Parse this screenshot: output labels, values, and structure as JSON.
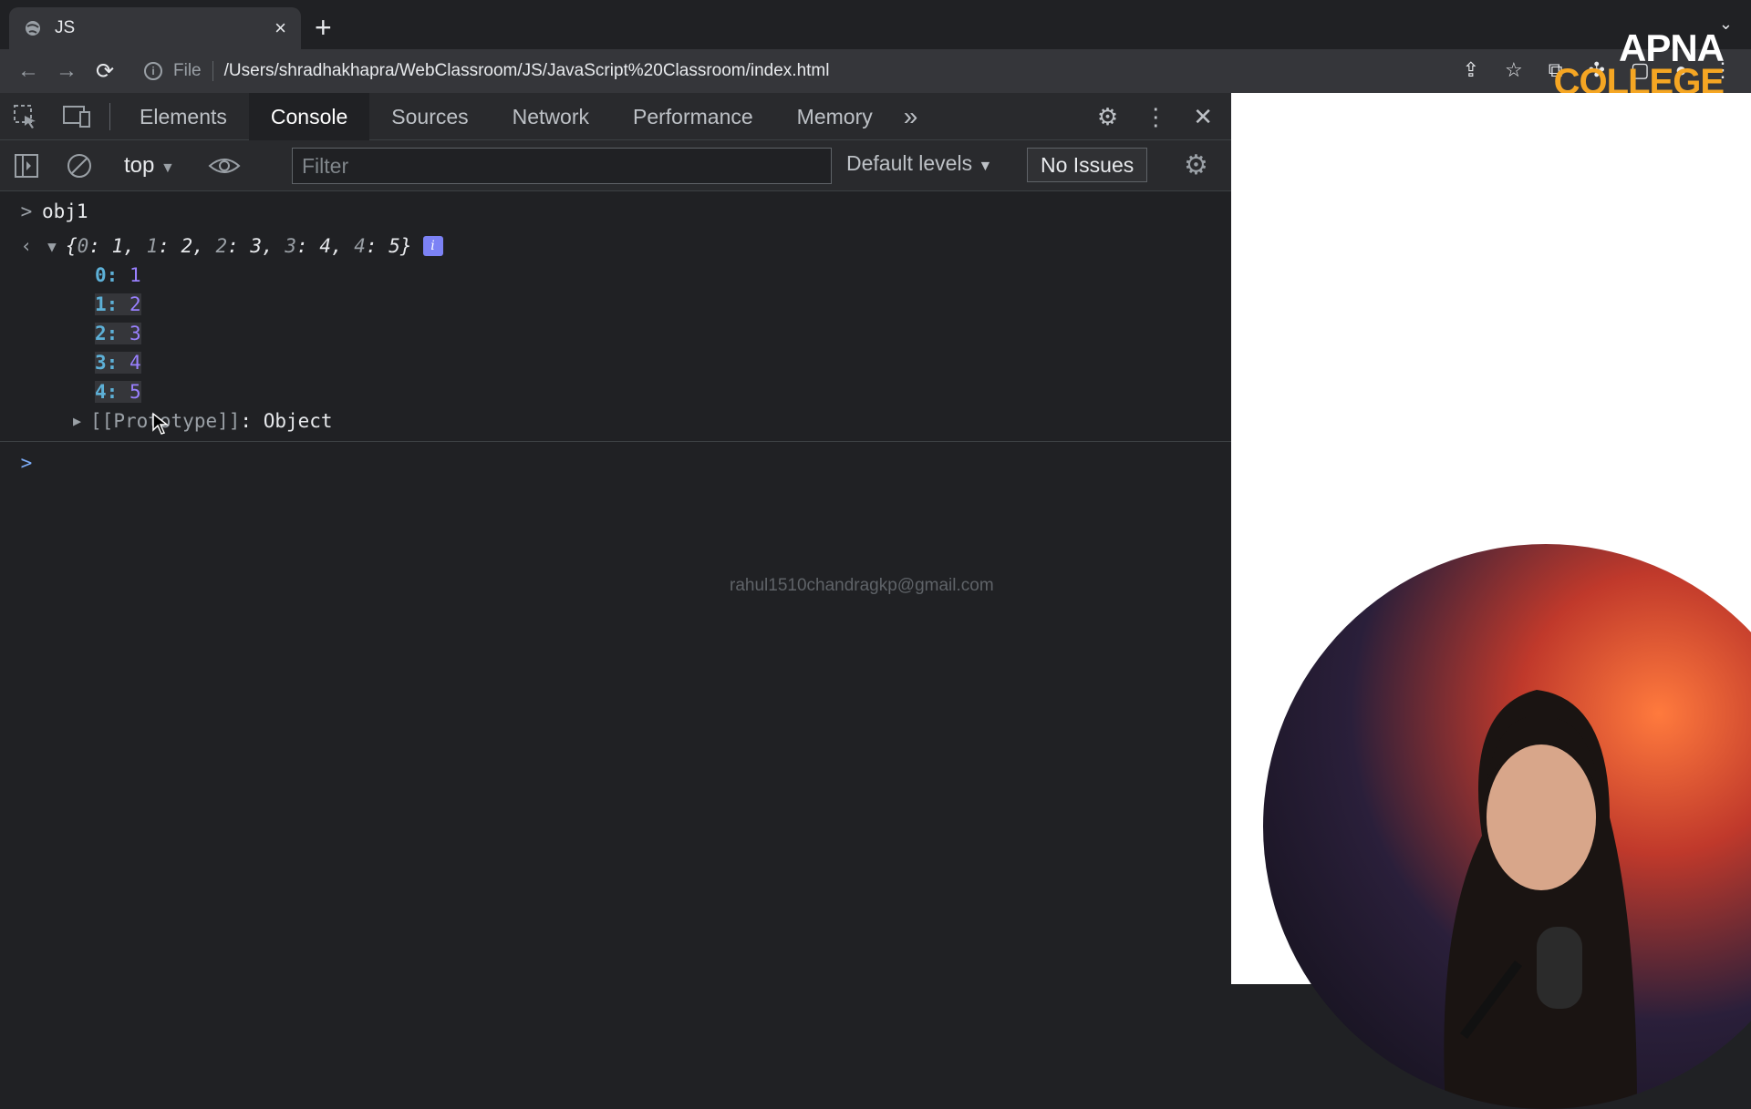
{
  "browser": {
    "tab_title": "JS",
    "tab_close": "×",
    "new_tab": "+",
    "url_scheme": "File",
    "url": "/Users/shradhakhapra/WebClassroom/JS/JavaScript%20Classroom/index.html"
  },
  "brand": {
    "line1": "APNA",
    "line2": "COLLEGE"
  },
  "devtools": {
    "tabs": [
      "Elements",
      "Console",
      "Sources",
      "Network",
      "Performance",
      "Memory"
    ],
    "active_tab": "Console",
    "context": "top",
    "filter_placeholder": "Filter",
    "levels": "Default levels",
    "issues": "No Issues"
  },
  "console": {
    "input": "obj1",
    "summary_keys": [
      "0",
      "1",
      "2",
      "3",
      "4"
    ],
    "summary_values": [
      "1",
      "2",
      "3",
      "4",
      "5"
    ],
    "entries": [
      {
        "key": "0",
        "value": "1"
      },
      {
        "key": "1",
        "value": "2"
      },
      {
        "key": "2",
        "value": "3"
      },
      {
        "key": "3",
        "value": "4"
      },
      {
        "key": "4",
        "value": "5"
      }
    ],
    "prototype_label": "[[Prototype]]",
    "prototype_value": "Object"
  },
  "watermark_email": "rahul1510chandragkp@gmail.com",
  "colors": {
    "key": "#5db0d7",
    "value": "#9980ff",
    "brand_orange": "#f5a623"
  }
}
